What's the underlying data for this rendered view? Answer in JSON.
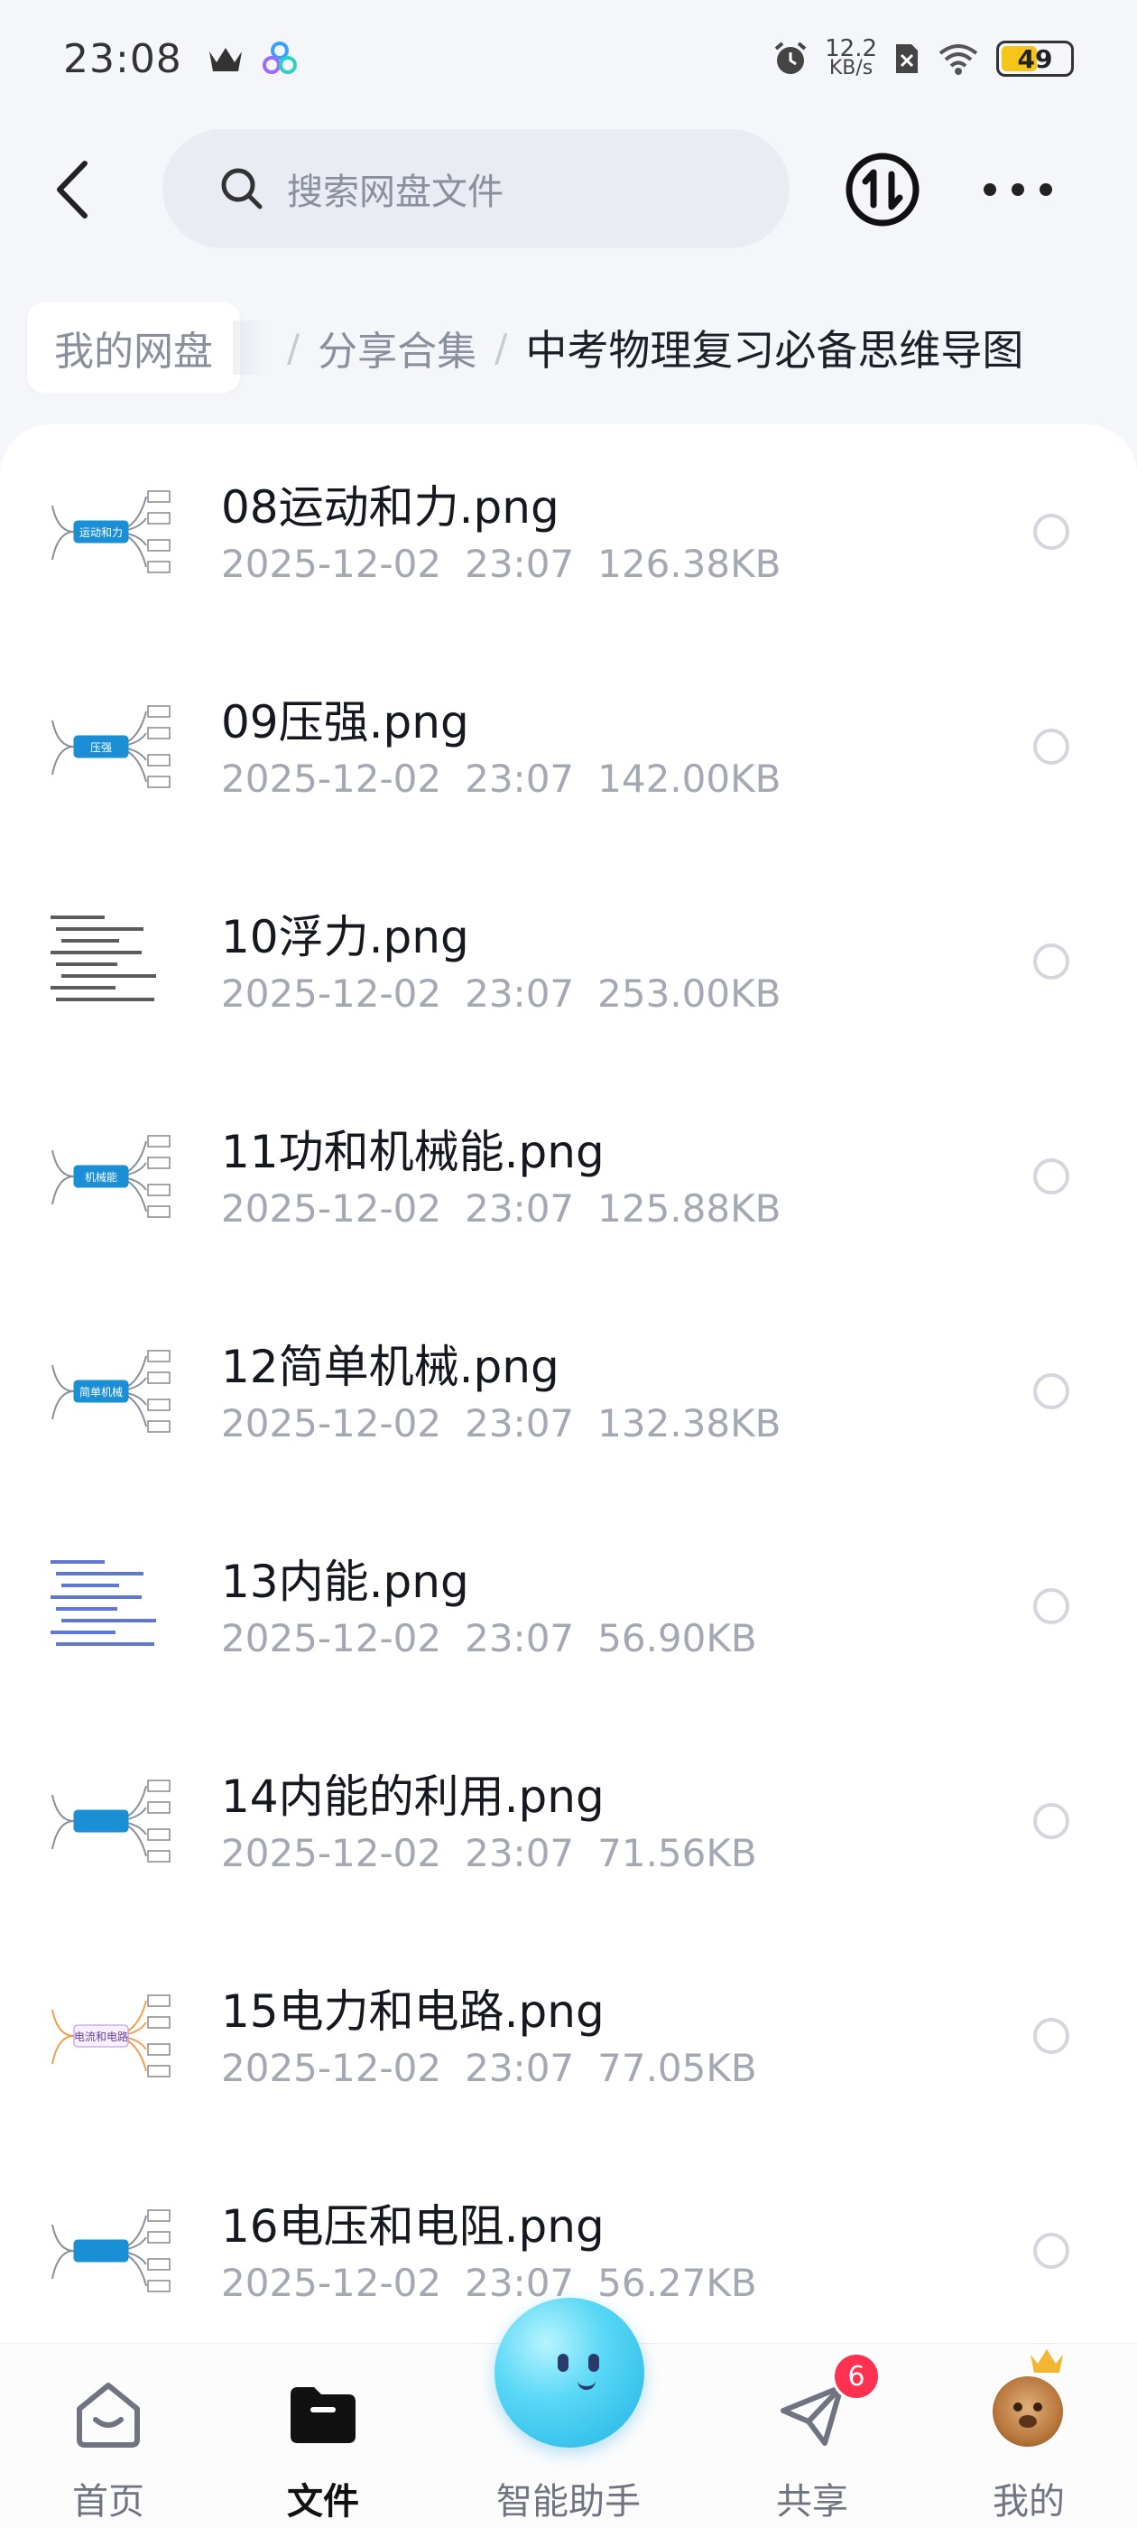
{
  "status_bar": {
    "time": "23:08",
    "net_speed_value": "12.2",
    "net_speed_unit": "KB/s",
    "battery": "49"
  },
  "header": {
    "search_placeholder": "搜索网盘文件"
  },
  "breadcrumb": {
    "root": "我的网盘",
    "middle": "分享合集",
    "current": "中考物理复习必备思维导图",
    "separator": "/"
  },
  "files": [
    {
      "name": "08运动和力.png",
      "date": "2025-12-02",
      "time": "23:07",
      "size": "126.38KB"
    },
    {
      "name": "09压强.png",
      "date": "2025-12-02",
      "time": "23:07",
      "size": "142.00KB"
    },
    {
      "name": "10浮力.png",
      "date": "2025-12-02",
      "time": "23:07",
      "size": "253.00KB"
    },
    {
      "name": "11功和机械能.png",
      "date": "2025-12-02",
      "time": "23:07",
      "size": "125.88KB"
    },
    {
      "name": "12简单机械.png",
      "date": "2025-12-02",
      "time": "23:07",
      "size": "132.38KB"
    },
    {
      "name": "13内能.png",
      "date": "2025-12-02",
      "time": "23:07",
      "size": "56.90KB"
    },
    {
      "name": "14内能的利用.png",
      "date": "2025-12-02",
      "time": "23:07",
      "size": "71.56KB"
    },
    {
      "name": "15电力和电路.png",
      "date": "2025-12-02",
      "time": "23:07",
      "size": "77.05KB"
    },
    {
      "name": "16电压和电阻.png",
      "date": "2025-12-02",
      "time": "23:07",
      "size": "56.27KB"
    }
  ],
  "thumb_labels": [
    "运动和力",
    "压强",
    "",
    "机械能",
    "简单机械",
    "",
    "",
    "电流和电路",
    ""
  ],
  "bottom_nav": {
    "home": "首页",
    "files": "文件",
    "assistant": "智能助手",
    "share": "共享",
    "mine": "我的",
    "share_badge": "6"
  },
  "colors": {
    "accent": "#1a8fd6",
    "badge": "#ff3150",
    "battery": "#f5c518"
  }
}
